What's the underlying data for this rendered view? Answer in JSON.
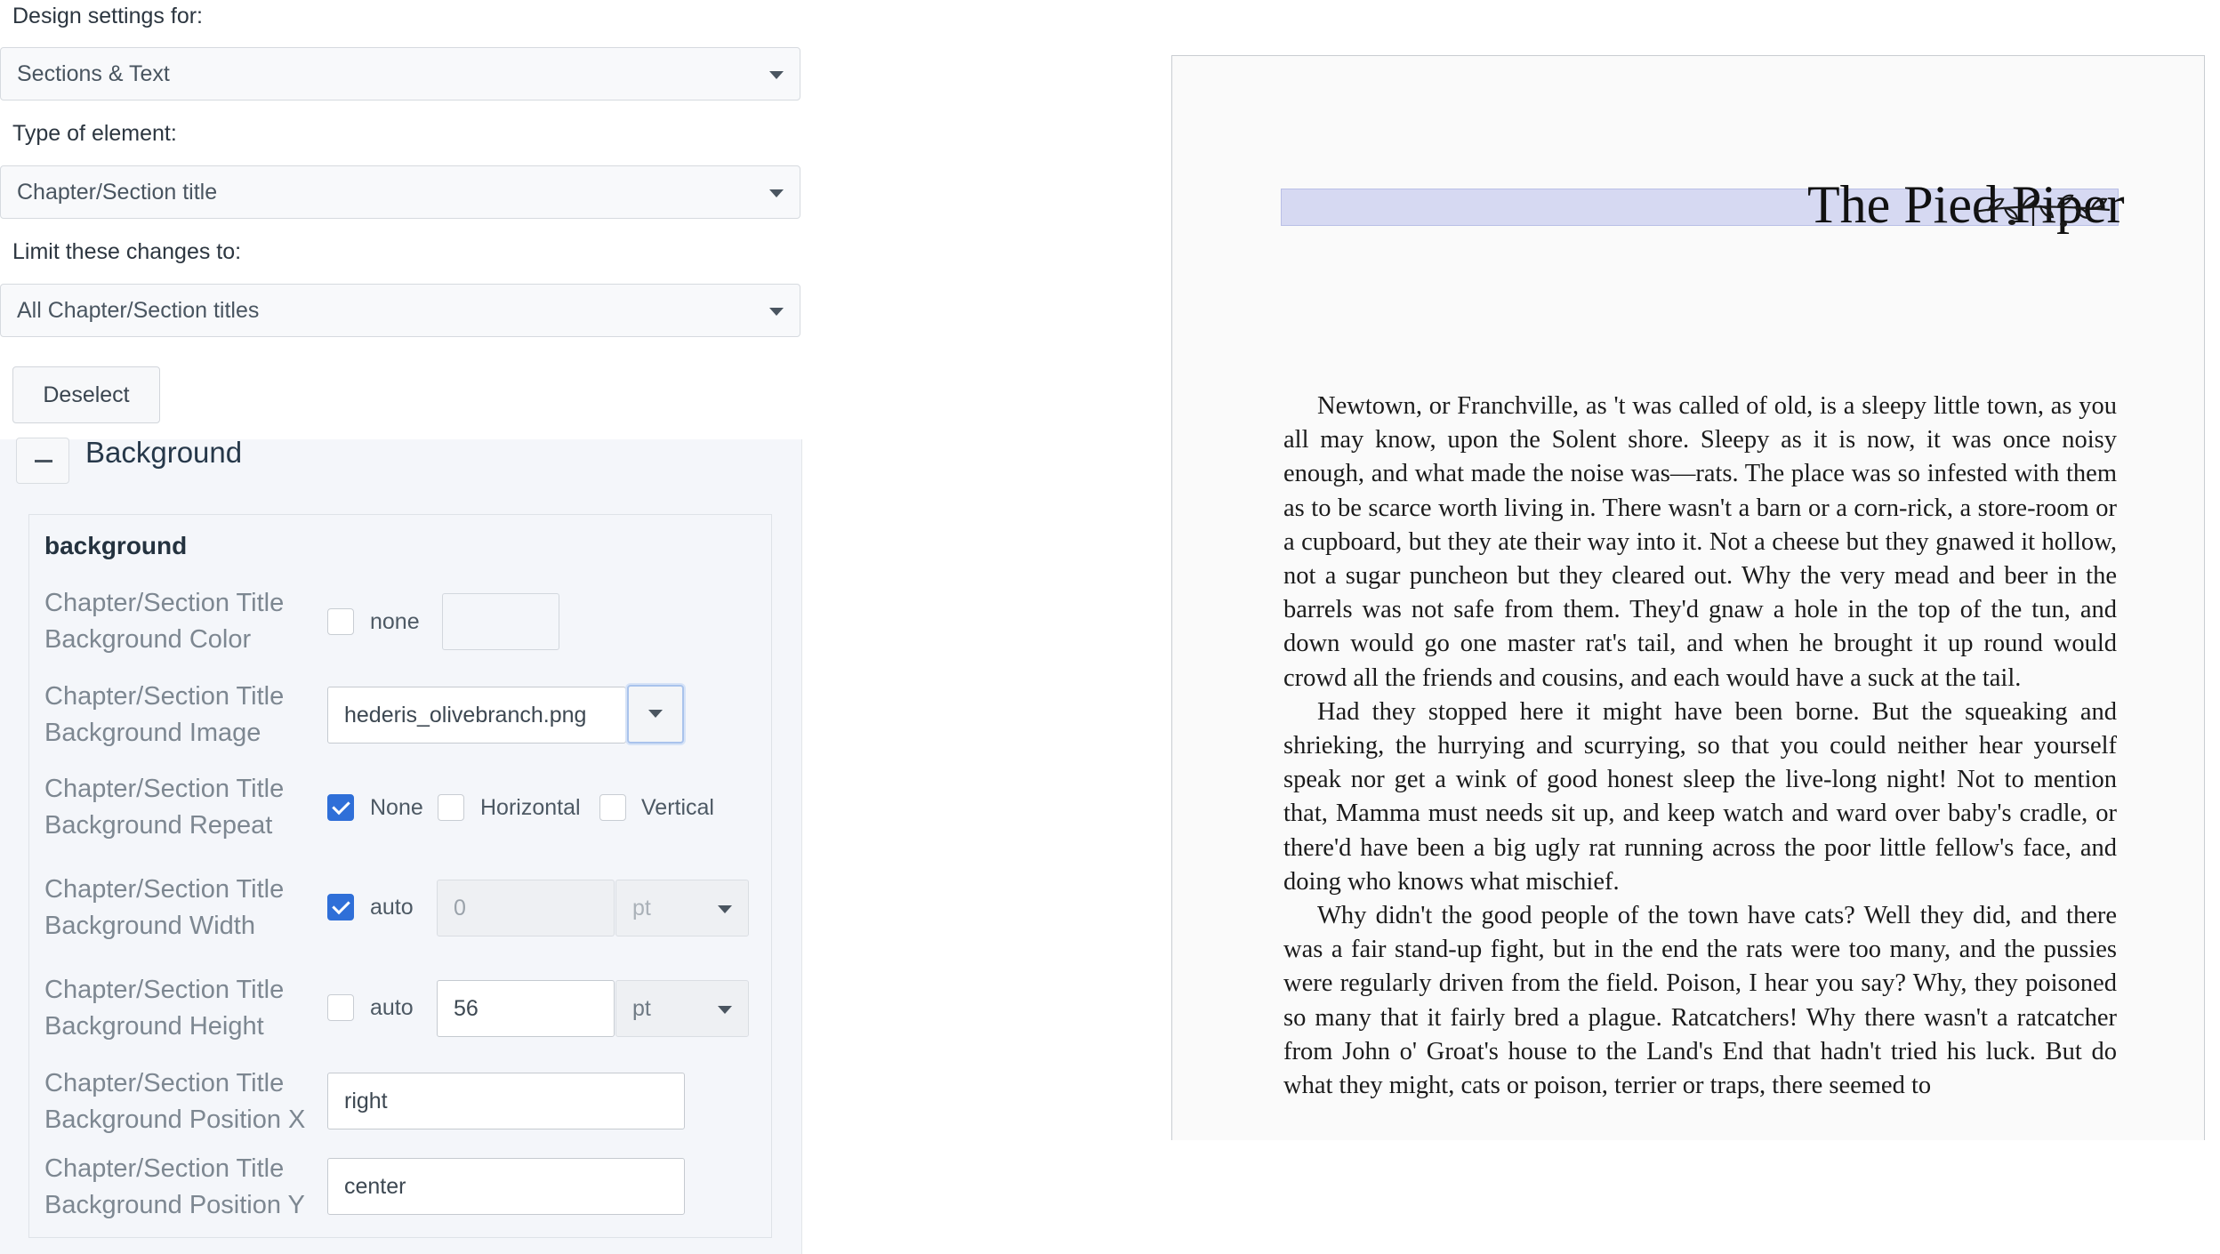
{
  "design_settings": {
    "label": "Design settings for:",
    "value": "Sections & Text"
  },
  "element_type": {
    "label": "Type of element:",
    "value": "Chapter/Section title"
  },
  "limit_changes": {
    "label": "Limit these changes to:",
    "value": "All Chapter/Section titles"
  },
  "deselect_label": "Deselect",
  "section": {
    "title": "Background",
    "group_title": "background",
    "fields": {
      "bg_color": {
        "label": "Chapter/Section Title Background Color",
        "none_label": "none",
        "none_checked": false
      },
      "bg_image": {
        "label": "Chapter/Section Title Background Image",
        "value": "hederis_olivebranch.png"
      },
      "bg_repeat": {
        "label": "Chapter/Section Title Background Repeat",
        "options": [
          {
            "label": "None",
            "checked": true
          },
          {
            "label": "Horizontal",
            "checked": false
          },
          {
            "label": "Vertical",
            "checked": false
          }
        ]
      },
      "bg_width": {
        "label": "Chapter/Section Title Background Width",
        "auto_label": "auto",
        "auto_checked": true,
        "value": "0",
        "unit": "pt"
      },
      "bg_height": {
        "label": "Chapter/Section Title Background Height",
        "auto_label": "auto",
        "auto_checked": false,
        "value": "56",
        "unit": "pt"
      },
      "bg_pos_x": {
        "label": "Chapter/Section Title Background Position X",
        "value": "right"
      },
      "bg_pos_y": {
        "label": "Chapter/Section Title Background Position Y",
        "value": "center"
      }
    }
  },
  "preview": {
    "chapter_title": "The Pied Piper",
    "paragraphs": [
      "Newtown, or Franchville, as 't was called of old, is a sleepy little town, as you all may know, upon the Solent shore. Sleepy as it is now, it was once noisy enough, and what made the noise was—rats. The place was so infested with them as to be scarce worth living in. There wasn't a barn or a corn-rick, a store-room or a cupboard, but they ate their way into it. Not a cheese but they gnawed it hollow, not a sugar puncheon but they cleared out. Why the very mead and beer in the barrels was not safe from them. They'd gnaw a hole in the top of the tun, and down would go one master rat's tail, and when he brought it up round would crowd all the friends and cousins, and each would have a suck at the tail.",
      "Had they stopped here it might have been borne. But the squeaking and shrieking, the hurrying and scurrying, so that you could neither hear yourself speak nor get a wink of good honest sleep the live-long night! Not to mention that, Mamma must needs sit up, and keep watch and ward over baby's cradle, or there'd have been a big ugly rat running across the poor little fellow's face, and doing who knows what mischief.",
      "Why didn't the good people of the town have cats? Well they did, and there was a fair stand-up fight, but in the end the rats were too many, and the pussies were regularly driven from the field. Poison, I hear you say? Why, they poisoned so many that it fairly bred a plague. Ratcatchers! Why there wasn't a ratcatcher from John o' Groat's house to the Land's End that hadn't tried his luck. But do what they might, cats or poison, terrier or traps, there seemed to"
    ]
  },
  "colors": {
    "accent": "#2f6fd8",
    "title_highlight": "#d6d9f2"
  }
}
